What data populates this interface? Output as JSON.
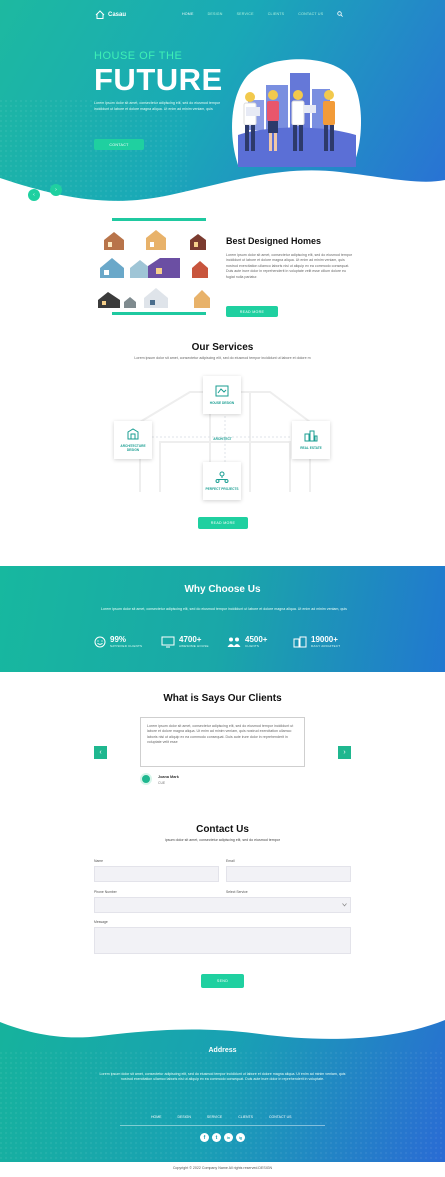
{
  "nav": {
    "brand": "Casau",
    "links": [
      "HOME",
      "DESIGN",
      "SERVICE",
      "CLIENTS",
      "CONTACT US"
    ]
  },
  "hero": {
    "subtitle": "HOUSE OF THE",
    "title": "FUTURE",
    "text": "Lorem ipsum dolor sit amet, consectetur adipiscing elit, sed do eiusmod tempor incididunt ut labore et dolore magna aliqua. Ut enim ad minim veniam, quis",
    "button": "CONTACT",
    "prev": "‹",
    "next": "›"
  },
  "best": {
    "title": "Best Designed Homes",
    "text": "Lorem ipsum dolor sit amet, consectetur adipiscing elit, sed do eiusmod tempor incididunt ut labore et dolore magna aliqua. Ut enim ad minim veniam, quis nostrud exercitation ullamco laboris nisi ut aliquip ex ea commodo consequat. Duis aute irure dolor in reprehenderit in voluptate velit esse cillum dolore eu fugiat nulla pariatur.",
    "button": "READ MORE"
  },
  "services": {
    "title": "Our Services",
    "subtitle": "Lorem ipsum dolor sit amet, consectetur adipiscing elit, sed do eiusmod tempor incididunt ut labore et dolore m",
    "items": [
      "HOUSE DESIGN",
      "ARCHITECTURE DESIGN",
      "ARCHITECT",
      "REAL ESTATE",
      "PERFECT PROJECTS"
    ],
    "button": "READ MORE"
  },
  "why": {
    "title": "Why Choose Us",
    "text": "Lorem ipsum dolor sit amet, consectetur adipiscing elit, sed do eiusmod tempor incididunt ut labore et dolore magna aliqua. Ut enim ad minim veniam, quis",
    "stats": [
      {
        "value": "99%",
        "label": "SATISFIED CLIENTS"
      },
      {
        "value": "4700+",
        "label": "AWESOME HOUSE"
      },
      {
        "value": "4500+",
        "label": "CLIENTS"
      },
      {
        "value": "19000+",
        "label": "DAILY ARCHITECT"
      }
    ]
  },
  "testimonials": {
    "title": "What is Says Our Clients",
    "quote": "Lorem ipsum dolor sit amet, consectetur adipiscing elit, sed do eiusmod tempor incididunt ut labore et dolore magna aliqua. Ut enim ad minim veniam, quis nostrud exercitation ullamco laboris nisi ut aliquip ex ea commodo consequat. Duis aute irure dolor in reprehenderit in voluptate velit esse",
    "name": "Joana Mark",
    "role": "CUE",
    "prev": "‹",
    "next": "›"
  },
  "contact": {
    "title": "Contact Us",
    "subtitle": "ipsum dolor sit amet, consectetur adipiscing elit, sed do eiusmod tempor",
    "labels": {
      "name": "Name",
      "email": "Email",
      "phone": "Phone Number",
      "service": "Select Service",
      "message": "Message"
    },
    "button": "SEND"
  },
  "footer": {
    "title": "Address",
    "text": "Lorem ipsum dolor sit amet, consectetur adipiscing elit, sed do eiusmod tempor incididunt ut labore et dolore magna aliqua. Ut enim ad minim veniam, quis nostrud exercitation ullamco laboris nisi ut aliquip ex ea commodo consequat. Duis aute irure dolor in reprehenderit in voluptate.",
    "links": [
      "HOME",
      "DESIGN",
      "SERVICE",
      "CLIENTS",
      "CONTACT US"
    ],
    "social": [
      "f",
      "t",
      "in",
      "ig"
    ],
    "copyright": "Copyright © 2022 Company Name All rights reserved.DESIGN"
  },
  "colors": {
    "accent": "#1fd0a0",
    "blue": "#2a6fd6",
    "teal": "#16b39c"
  }
}
